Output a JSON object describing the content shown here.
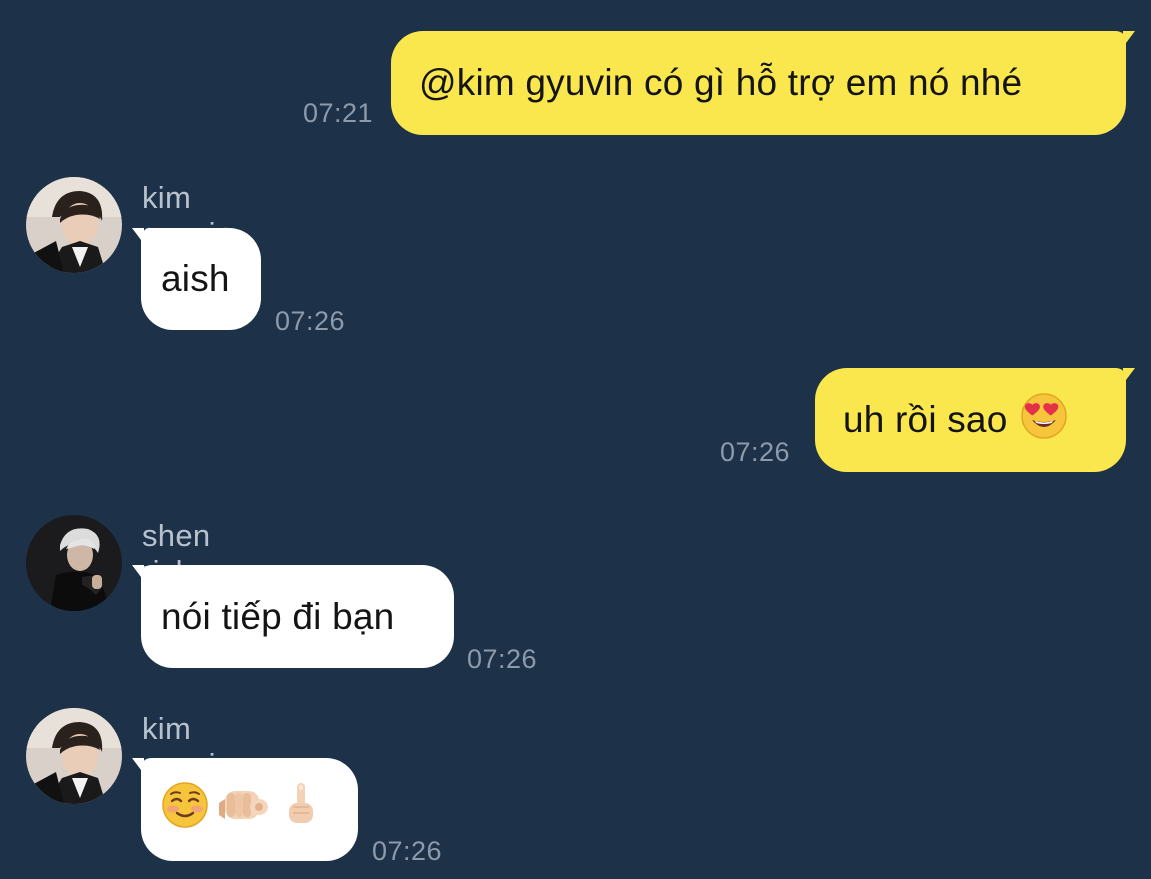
{
  "messages": [
    {
      "direction": "out",
      "text": "@kim gyuvin có gì hỗ trợ em nó nhé",
      "time": "07:21"
    },
    {
      "direction": "in",
      "sender": "kim gyuvin",
      "text": "aish",
      "time": "07:26"
    },
    {
      "direction": "out",
      "text": "uh rồi sao",
      "emoji": "heart-eyes",
      "time": "07:26"
    },
    {
      "direction": "in",
      "sender": "shen ricky",
      "text": "nói tiếp đi bạn",
      "time": "07:26"
    },
    {
      "direction": "in",
      "sender": "kim gyuvin",
      "emoji": [
        "smiling-blush",
        "pointing-at-viewer",
        "pointing-up"
      ],
      "time": "07:26"
    }
  ],
  "colors": {
    "background": "#1d3148",
    "outgoing_bubble": "#f9e74d",
    "incoming_bubble": "#ffffff",
    "timestamp": "#8d9aab",
    "sender_name": "#b8c2cf"
  }
}
